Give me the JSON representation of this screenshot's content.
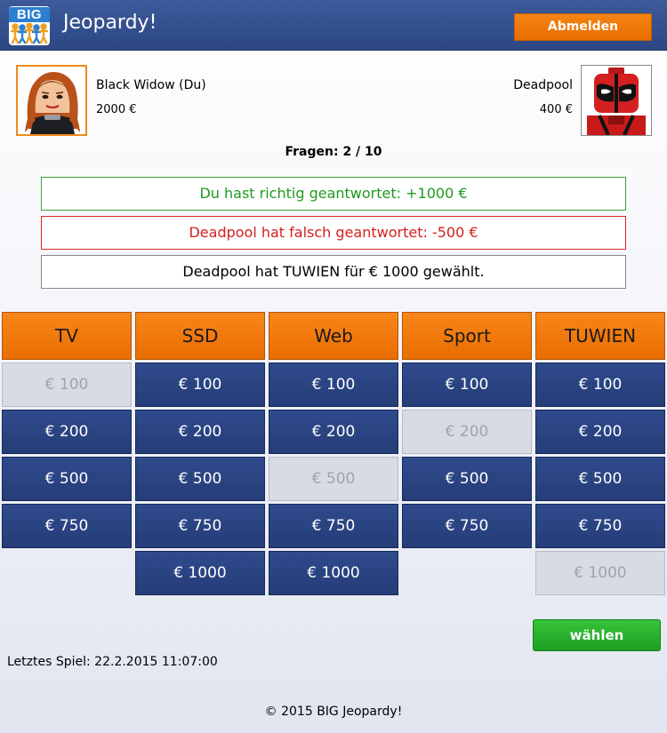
{
  "header": {
    "logo_text": "BIG",
    "title": "Jeopardy!",
    "logout_label": "Abmelden"
  },
  "players": {
    "you": {
      "name": "Black Widow (Du)",
      "score": "2000 €"
    },
    "opponent": {
      "name": "Deadpool",
      "score": "400 €"
    }
  },
  "question_count": "Fragen: 2 / 10",
  "messages": {
    "correct": "Du hast richtig geantwortet: +1000 €",
    "wrong": "Deadpool hat falsch geantwortet: -500 €",
    "info": "Deadpool hat TUWIEN für € 1000 gewählt."
  },
  "board": {
    "categories": [
      {
        "name": "TV",
        "cells": [
          {
            "label": "€ 100",
            "used": true
          },
          {
            "label": "€ 200",
            "used": false
          },
          {
            "label": "€ 500",
            "used": false
          },
          {
            "label": "€ 750",
            "used": false
          }
        ]
      },
      {
        "name": "SSD",
        "cells": [
          {
            "label": "€ 100",
            "used": false
          },
          {
            "label": "€ 200",
            "used": false
          },
          {
            "label": "€ 500",
            "used": false
          },
          {
            "label": "€ 750",
            "used": false
          },
          {
            "label": "€ 1000",
            "used": false
          }
        ]
      },
      {
        "name": "Web",
        "cells": [
          {
            "label": "€ 100",
            "used": false
          },
          {
            "label": "€ 200",
            "used": false
          },
          {
            "label": "€ 500",
            "used": true
          },
          {
            "label": "€ 750",
            "used": false
          },
          {
            "label": "€ 1000",
            "used": false
          }
        ]
      },
      {
        "name": "Sport",
        "cells": [
          {
            "label": "€ 100",
            "used": false
          },
          {
            "label": "€ 200",
            "used": true
          },
          {
            "label": "€ 500",
            "used": false
          },
          {
            "label": "€ 750",
            "used": false
          }
        ]
      },
      {
        "name": "TUWIEN",
        "cells": [
          {
            "label": "€ 100",
            "used": false
          },
          {
            "label": "€ 200",
            "used": false
          },
          {
            "label": "€ 500",
            "used": false
          },
          {
            "label": "€ 750",
            "used": false
          },
          {
            "label": "€ 1000",
            "used": true
          }
        ]
      }
    ]
  },
  "choose_label": "wählen",
  "last_game": "Letztes Spiel: 22.2.2015 11:07:00",
  "footer": "© 2015 BIG Jeopardy!",
  "colors": {
    "header_blue": "#2f4a8c",
    "accent_orange": "#ea6d00",
    "cell_blue": "#2a4482",
    "used_gray": "#d9dbe3",
    "correct_green": "#1f9a1f",
    "wrong_red": "#d42020",
    "choose_green": "#2bb12f"
  },
  "icons": {
    "logo": "big-logo-icon",
    "you_avatar": "black-widow-avatar",
    "opponent_avatar": "deadpool-avatar"
  }
}
